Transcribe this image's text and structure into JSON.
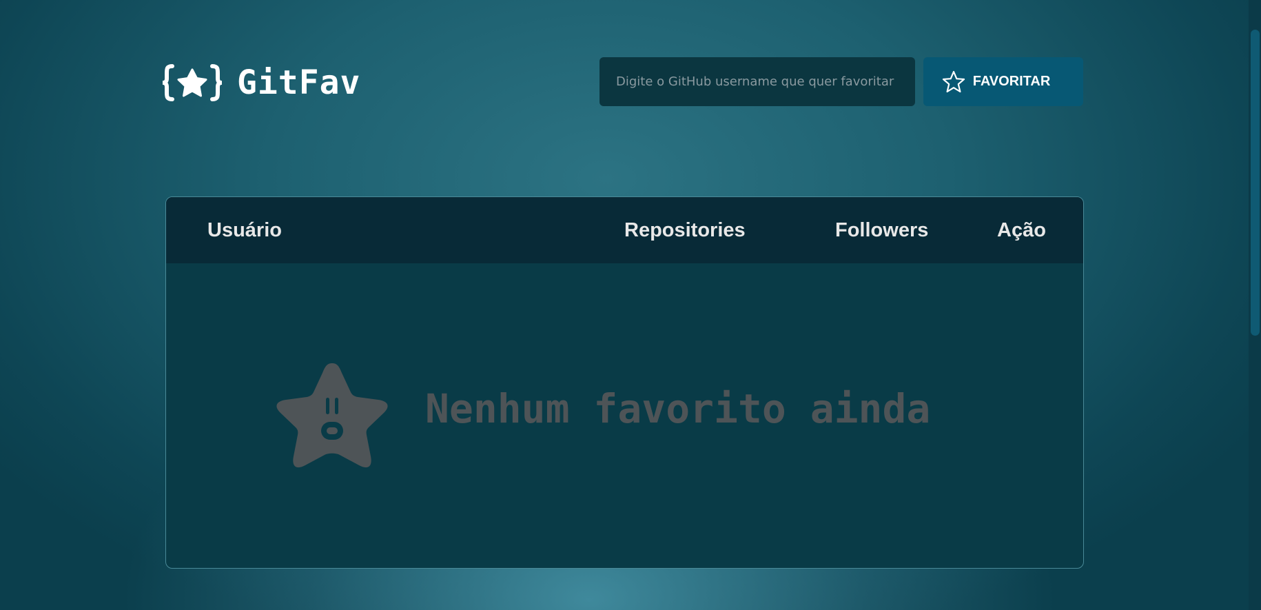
{
  "header": {
    "logo_text": "GitFav",
    "logo_icon": "braces-star-icon",
    "search": {
      "placeholder": "Digite o GitHub username que quer favoritar",
      "value": ""
    },
    "favorite_button": {
      "label": "FAVORITAR",
      "icon": "star-outline-icon"
    }
  },
  "table": {
    "columns": [
      "Usuário",
      "Repositories",
      "Followers",
      "Ação"
    ],
    "rows": []
  },
  "empty_state": {
    "icon": "surprised-star-icon",
    "message": "Nenhum favorito ainda"
  },
  "colors": {
    "background": "#1d6070",
    "table_header": "#082a37",
    "table_body": "#093b47",
    "button": "#075874",
    "input": "#0b3640",
    "empty_text": "#4e5457"
  }
}
